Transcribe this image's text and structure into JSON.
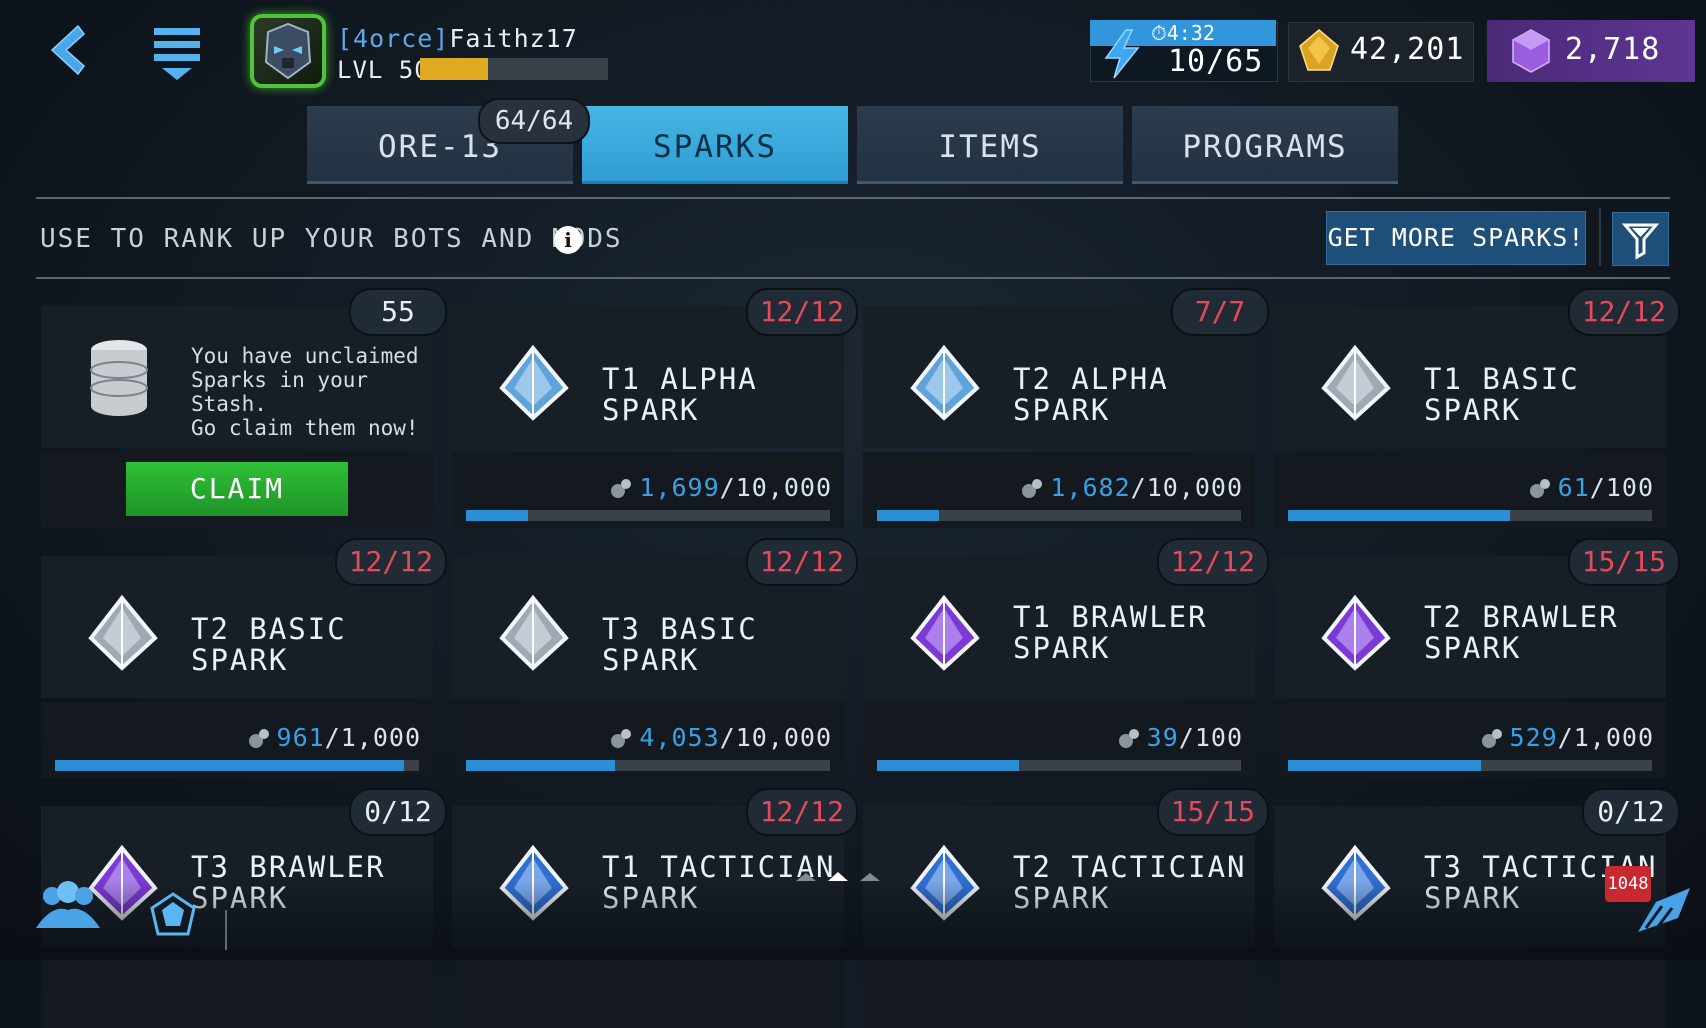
{
  "header": {
    "player_tag": "[4orce]",
    "player_name": "Faithz17",
    "level_label": "LVL 50",
    "xp_progress": 0.36,
    "energy_timer": "⏱4:32",
    "energy_count": "10/65",
    "gold": "42,201",
    "gems": "2,718"
  },
  "tabs": [
    {
      "label": "ORE-13",
      "badge": "64/64"
    },
    {
      "label": "SPARKS",
      "active": true
    },
    {
      "label": "ITEMS"
    },
    {
      "label": "PROGRAMS"
    }
  ],
  "toolbar": {
    "subtitle": "USE TO RANK UP YOUR BOTS AND MODS",
    "get_more_label": "GET MORE SPARKS!"
  },
  "stash": {
    "count": "55",
    "message_line1": "You have unclaimed",
    "message_line2": "Sparks in your Stash.",
    "message_line3": "Go claim them now!",
    "claim_label": "CLAIM"
  },
  "sparks": [
    {
      "name1": "T1 ALPHA SPARK",
      "name2": "",
      "count": "12/12",
      "count_color": "red",
      "current": "1,699",
      "max": "10,000",
      "progress": 0.17,
      "icon": "alpha-spark-icon"
    },
    {
      "name1": "T2 ALPHA SPARK",
      "name2": "",
      "count": "7/7",
      "count_color": "red",
      "current": "1,682",
      "max": "10,000",
      "progress": 0.17,
      "icon": "alpha-spark-icon"
    },
    {
      "name1": "T1 BASIC SPARK",
      "name2": "",
      "count": "12/12",
      "count_color": "red",
      "current": "61",
      "max": "100",
      "progress": 0.61,
      "icon": "basic-spark-icon"
    },
    {
      "name1": "T2 BASIC SPARK",
      "name2": "",
      "count": "12/12",
      "count_color": "red",
      "current": "961",
      "max": "1,000",
      "progress": 0.96,
      "icon": "basic-spark-icon"
    },
    {
      "name1": "T3 BASIC SPARK",
      "name2": "",
      "count": "12/12",
      "count_color": "red",
      "current": "4,053",
      "max": "10,000",
      "progress": 0.41,
      "icon": "basic-spark-icon"
    },
    {
      "name1": "T1 BRAWLER",
      "name2": "SPARK",
      "count": "12/12",
      "count_color": "red",
      "current": "39",
      "max": "100",
      "progress": 0.39,
      "icon": "brawler-spark-icon"
    },
    {
      "name1": "T2 BRAWLER",
      "name2": "SPARK",
      "count": "15/15",
      "count_color": "red",
      "current": "529",
      "max": "1,000",
      "progress": 0.53,
      "icon": "brawler-spark-icon"
    },
    {
      "name1": "T3 BRAWLER",
      "name2": "SPARK",
      "count": "0/12",
      "count_color": "normal",
      "icon": "brawler-spark-icon"
    },
    {
      "name1": "T1 TACTICIAN",
      "name2": "SPARK",
      "count": "12/12",
      "count_color": "red",
      "icon": "tactician-spark-icon"
    },
    {
      "name1": "T2 TACTICIAN",
      "name2": "SPARK",
      "count": "15/15",
      "count_color": "red",
      "icon": "tactician-spark-icon"
    },
    {
      "name1": "T3 TACTICIAN",
      "name2": "SPARK",
      "count": "0/12",
      "count_color": "normal",
      "icon": "tactician-spark-icon"
    }
  ],
  "bottom": {
    "notification_count": "1048"
  },
  "colors": {
    "accent_blue": "#3296dd",
    "count_red": "#e8485a",
    "claim_green": "#2ec036",
    "gem_purple": "#5e3592",
    "xp_gold": "#e0aa20"
  }
}
